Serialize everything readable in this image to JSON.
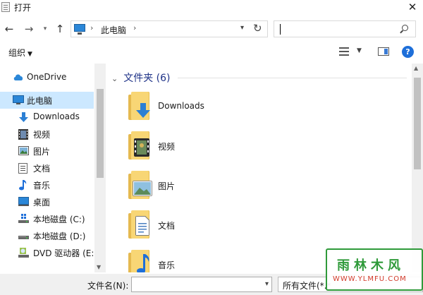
{
  "window": {
    "title": "打开"
  },
  "address": {
    "location": "此电脑",
    "search_placeholder": ""
  },
  "toolbar": {
    "organize_label": "组织"
  },
  "sidebar": {
    "items": [
      {
        "label": "OneDrive",
        "icon": "cloud-icon"
      },
      {
        "label": "此电脑",
        "icon": "computer-icon"
      },
      {
        "label": "Downloads",
        "icon": "download-arrow-icon"
      },
      {
        "label": "视频",
        "icon": "video-icon"
      },
      {
        "label": "图片",
        "icon": "picture-icon"
      },
      {
        "label": "文档",
        "icon": "document-icon"
      },
      {
        "label": "音乐",
        "icon": "music-note-icon"
      },
      {
        "label": "桌面",
        "icon": "desktop-icon"
      },
      {
        "label": "本地磁盘 (C:)",
        "icon": "disk-icon"
      },
      {
        "label": "本地磁盘 (D:)",
        "icon": "disk-icon"
      },
      {
        "label": "DVD 驱动器 (E:",
        "icon": "dvd-drive-icon"
      }
    ],
    "selected": "此电脑"
  },
  "main": {
    "group_header": "文件夹 (6)",
    "folders": [
      {
        "label": "Downloads",
        "icon": "downloads-folder-icon"
      },
      {
        "label": "视频",
        "icon": "videos-folder-icon"
      },
      {
        "label": "图片",
        "icon": "pictures-folder-icon"
      },
      {
        "label": "文档",
        "icon": "documents-folder-icon"
      },
      {
        "label": "音乐",
        "icon": "music-folder-icon"
      }
    ]
  },
  "bottom": {
    "filename_label": "文件名(N):",
    "filename_value": "",
    "filter_label": "所有文件(*.*"
  },
  "watermark": {
    "title": "雨林木风",
    "url": "WWW.YLMFU.COM"
  },
  "colors": {
    "selection": "#cce8ff",
    "header_text": "#1e3287",
    "folder": "#f8d675",
    "accent": "#1e6fd9"
  }
}
